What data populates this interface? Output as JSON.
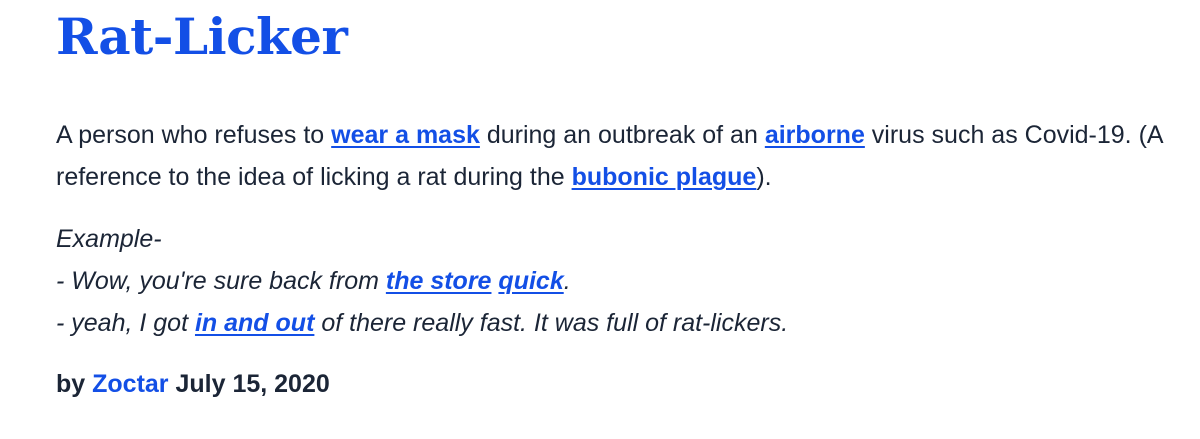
{
  "entry": {
    "word": "Rat-Licker",
    "meaning": {
      "part1": "A person who refuses to ",
      "link1": "wear a mask",
      "part2": " during an outbreak of an ",
      "link2": "airborne",
      "part3": " virus such as Covid-19. (A reference to the idea of licking a rat during the ",
      "link3": "bubonic plague",
      "part4": ")."
    },
    "example": {
      "heading": "Example-",
      "line1_part1": "- Wow, you're sure back from ",
      "line1_link1": "the store",
      "line1_space": " ",
      "line1_link2": "quick",
      "line1_end": ".",
      "line2_part1": "- yeah, I got ",
      "line2_link1": "in and out",
      "line2_part2": " of there really fast. It was full of rat-lickers."
    },
    "contributor": {
      "by": "by ",
      "author": "Zoctar",
      "date": " July 15, 2020"
    }
  },
  "colors": {
    "link": "#134fe6",
    "text": "#1b2536",
    "background": "#ffffff"
  }
}
